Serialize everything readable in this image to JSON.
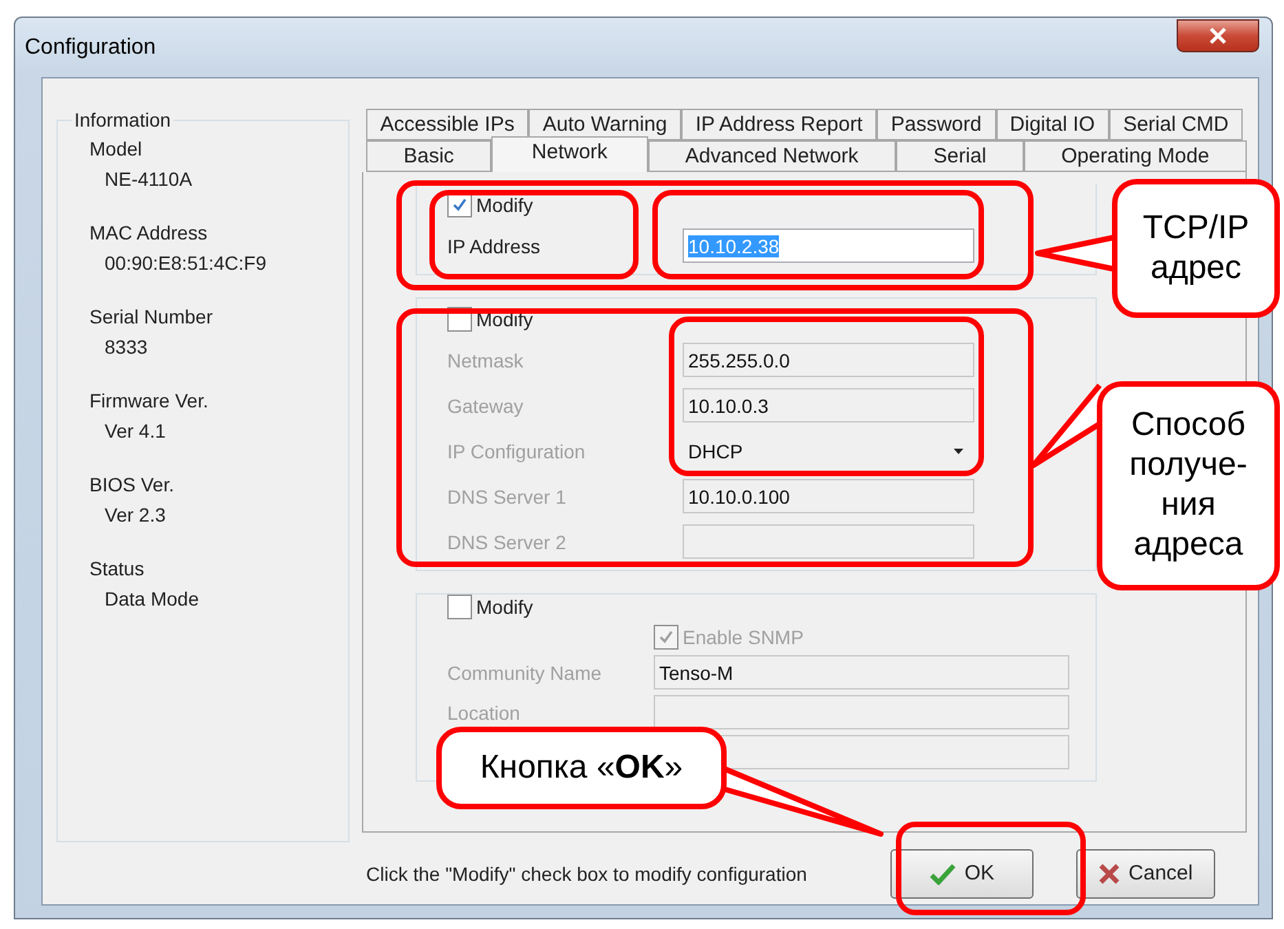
{
  "window": {
    "title": "Configuration"
  },
  "info": {
    "heading": "Information",
    "items": [
      {
        "label": "Model",
        "value": "NE-4110A"
      },
      {
        "label": "MAC Address",
        "value": "00:90:E8:51:4C:F9"
      },
      {
        "label": "Serial Number",
        "value": "8333"
      },
      {
        "label": "Firmware Ver.",
        "value": "Ver 4.1"
      },
      {
        "label": "BIOS Ver.",
        "value": "Ver 2.3"
      },
      {
        "label": "Status",
        "value": "Data Mode"
      }
    ]
  },
  "tabs": {
    "row_1": [
      {
        "label": "Accessible IPs",
        "selected": false
      },
      {
        "label": "Auto Warning",
        "selected": false
      },
      {
        "label": "IP Address Report",
        "selected": false
      },
      {
        "label": "Password",
        "selected": false
      },
      {
        "label": "Digital IO",
        "selected": false
      },
      {
        "label": "Serial CMD",
        "selected": false
      }
    ],
    "row_2": [
      {
        "label": "Basic",
        "selected": false
      },
      {
        "label": "Network",
        "selected": true
      },
      {
        "label": "Advanced Network",
        "selected": false
      },
      {
        "label": "Serial",
        "selected": false
      },
      {
        "label": "Operating Mode",
        "selected": false
      }
    ]
  },
  "groups": [
    {
      "modify": {
        "label": "Modify",
        "checked": true
      },
      "fields": [
        {
          "kind": "text",
          "label": "IP Address",
          "value": "10.10.2.38",
          "disabled": false,
          "selected": true
        }
      ]
    },
    {
      "modify": {
        "label": "Modify",
        "checked": false
      },
      "fields": [
        {
          "kind": "text",
          "label": "Netmask",
          "value": "255.255.0.0",
          "disabled": true
        },
        {
          "kind": "text",
          "label": "Gateway",
          "value": "10.10.0.3",
          "disabled": true
        },
        {
          "kind": "select",
          "label": "IP Configuration",
          "value": "DHCP",
          "disabled": true
        },
        {
          "kind": "text",
          "label": "DNS Server 1",
          "value": "10.10.0.100",
          "disabled": true
        },
        {
          "kind": "text",
          "label": "DNS Server 2",
          "disabled": true
        }
      ]
    },
    {
      "modify": {
        "label": "Modify",
        "checked": false
      },
      "fields": [
        {
          "kind": "checkbox",
          "label": "Enable SNMP",
          "checked": true,
          "disabled": true
        },
        {
          "kind": "text",
          "label": "Community Name",
          "value": "Tenso-M",
          "disabled": true
        },
        {
          "kind": "text",
          "label": "Location",
          "disabled": true
        },
        {
          "kind": "text",
          "disabled": true
        }
      ]
    }
  ],
  "hint": "Click the \"Modify\" check box to modify configuration",
  "buttons": [
    {
      "kind": "ok",
      "label": "OK"
    },
    {
      "kind": "cancel",
      "label": "Cancel"
    }
  ],
  "annotations": [
    {
      "text": "TCP/IP адрес"
    },
    {
      "text": "Способ получе-ния адреса"
    },
    {
      "text": "Кнопка «**OK**»"
    }
  ]
}
